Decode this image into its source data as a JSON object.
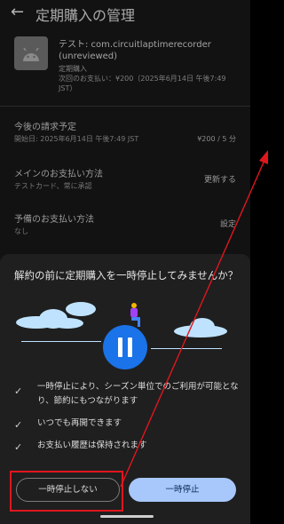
{
  "header": {
    "back_icon": "arrow-left-icon",
    "title": "定期購入の管理"
  },
  "subscription": {
    "app_icon": "android-icon",
    "name": "テスト: com.circuitlaptimerecorder (unreviewed)",
    "type": "定期購入",
    "next_payment": "次回のお支払い：¥200（2025年6月14日 午後7:49 JST）"
  },
  "billing": {
    "label": "今後の請求予定",
    "start": "開始日: 2025年6月14日 午後7:49 JST",
    "price": "¥200 / 5 分"
  },
  "main_payment": {
    "label": "メインのお支払い方法",
    "value": "テストカード、常に承認",
    "action": "更新する"
  },
  "backup_payment": {
    "label": "予備のお支払い方法",
    "value": "なし",
    "action": "設定"
  },
  "sheet": {
    "title": "解約の前に定期購入を一時停止してみませんか？",
    "illustration_icon": "pause-icon",
    "benefits": [
      "一時停止により、シーズン単位でのご利用が可能となり、節約にもつながります",
      "いつでも再開できます",
      "お支払い履歴は保持されます"
    ],
    "check_icon": "checkmark-icon",
    "secondary_button": "一時停止しない",
    "primary_button": "一時停止"
  },
  "colors": {
    "accent": "#1a73e8",
    "primary_button": "#a8c7fa",
    "highlight": "#e0161e",
    "annotation_arrow": "#e0161e"
  }
}
